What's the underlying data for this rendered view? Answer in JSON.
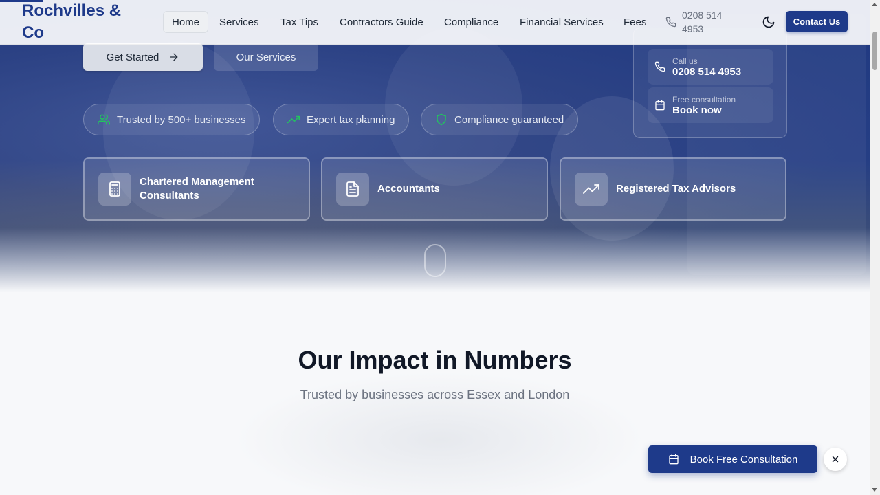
{
  "brand": {
    "name": "Rochvilles & Co",
    "accent": "#1e3a8a",
    "success": "#22c55e"
  },
  "nav": {
    "items": [
      {
        "label": "Home",
        "active": true
      },
      {
        "label": "Services"
      },
      {
        "label": "Tax Tips"
      },
      {
        "label": "Contractors Guide"
      },
      {
        "label": "Compliance"
      },
      {
        "label": "Financial Services"
      },
      {
        "label": "Fees"
      }
    ],
    "phone": "0208 514 4953",
    "contact_label": "Contact Us",
    "icons": {
      "phone": "phone-icon",
      "theme": "moon-icon"
    }
  },
  "hero": {
    "get_started_label": "Get Started",
    "our_services_label": "Our Services",
    "pills": [
      {
        "label": "Trusted by 500+ businesses",
        "icon": "users-icon"
      },
      {
        "label": "Expert tax planning",
        "icon": "trending-up-icon"
      },
      {
        "label": "Compliance guaranteed",
        "icon": "shield-icon"
      }
    ],
    "contact_card": {
      "call_caption": "Call us",
      "call_value": "0208 514 4953",
      "consult_caption": "Free consultation",
      "consult_value": "Book now"
    },
    "credentials": [
      {
        "label": "Chartered Management Consultants",
        "icon": "calculator-icon"
      },
      {
        "label": "Accountants",
        "icon": "document-icon"
      },
      {
        "label": "Registered Tax Advisors",
        "icon": "trending-up-icon"
      }
    ]
  },
  "impact": {
    "title": "Our Impact in Numbers",
    "subtitle": "Trusted by businesses across Essex and London"
  },
  "floating_cta": {
    "label": "Book Free Consultation",
    "icon": "calendar-icon"
  }
}
